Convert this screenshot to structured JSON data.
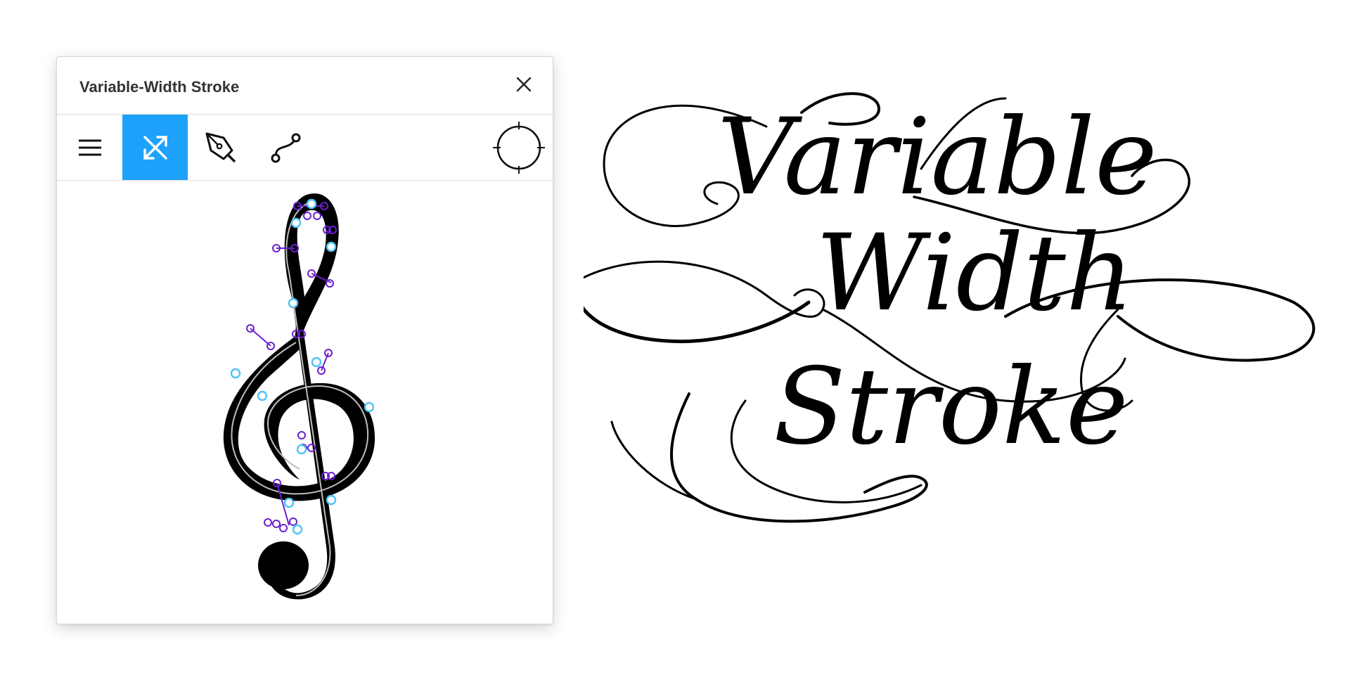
{
  "panel": {
    "title": "Variable-Width Stroke",
    "close_icon": "close-icon"
  },
  "toolbar": {
    "tools": [
      {
        "name": "menu",
        "icon": "hamburger-menu-icon",
        "active": false
      },
      {
        "name": "width",
        "icon": "crossing-arrows-icon",
        "active": true
      },
      {
        "name": "pen",
        "icon": "pen-nib-icon",
        "active": false
      },
      {
        "name": "path",
        "icon": "bezier-path-icon",
        "active": false
      }
    ],
    "target_icon": "crosshair-circle-icon"
  },
  "canvas": {
    "glyph": "treble-clef",
    "active_color": "#1ea1fb",
    "handle_color": "#6a1fd0",
    "anchor_color": "#4fc3f7"
  },
  "artwork": {
    "words": [
      "Variable",
      "Width",
      "Stroke"
    ]
  }
}
